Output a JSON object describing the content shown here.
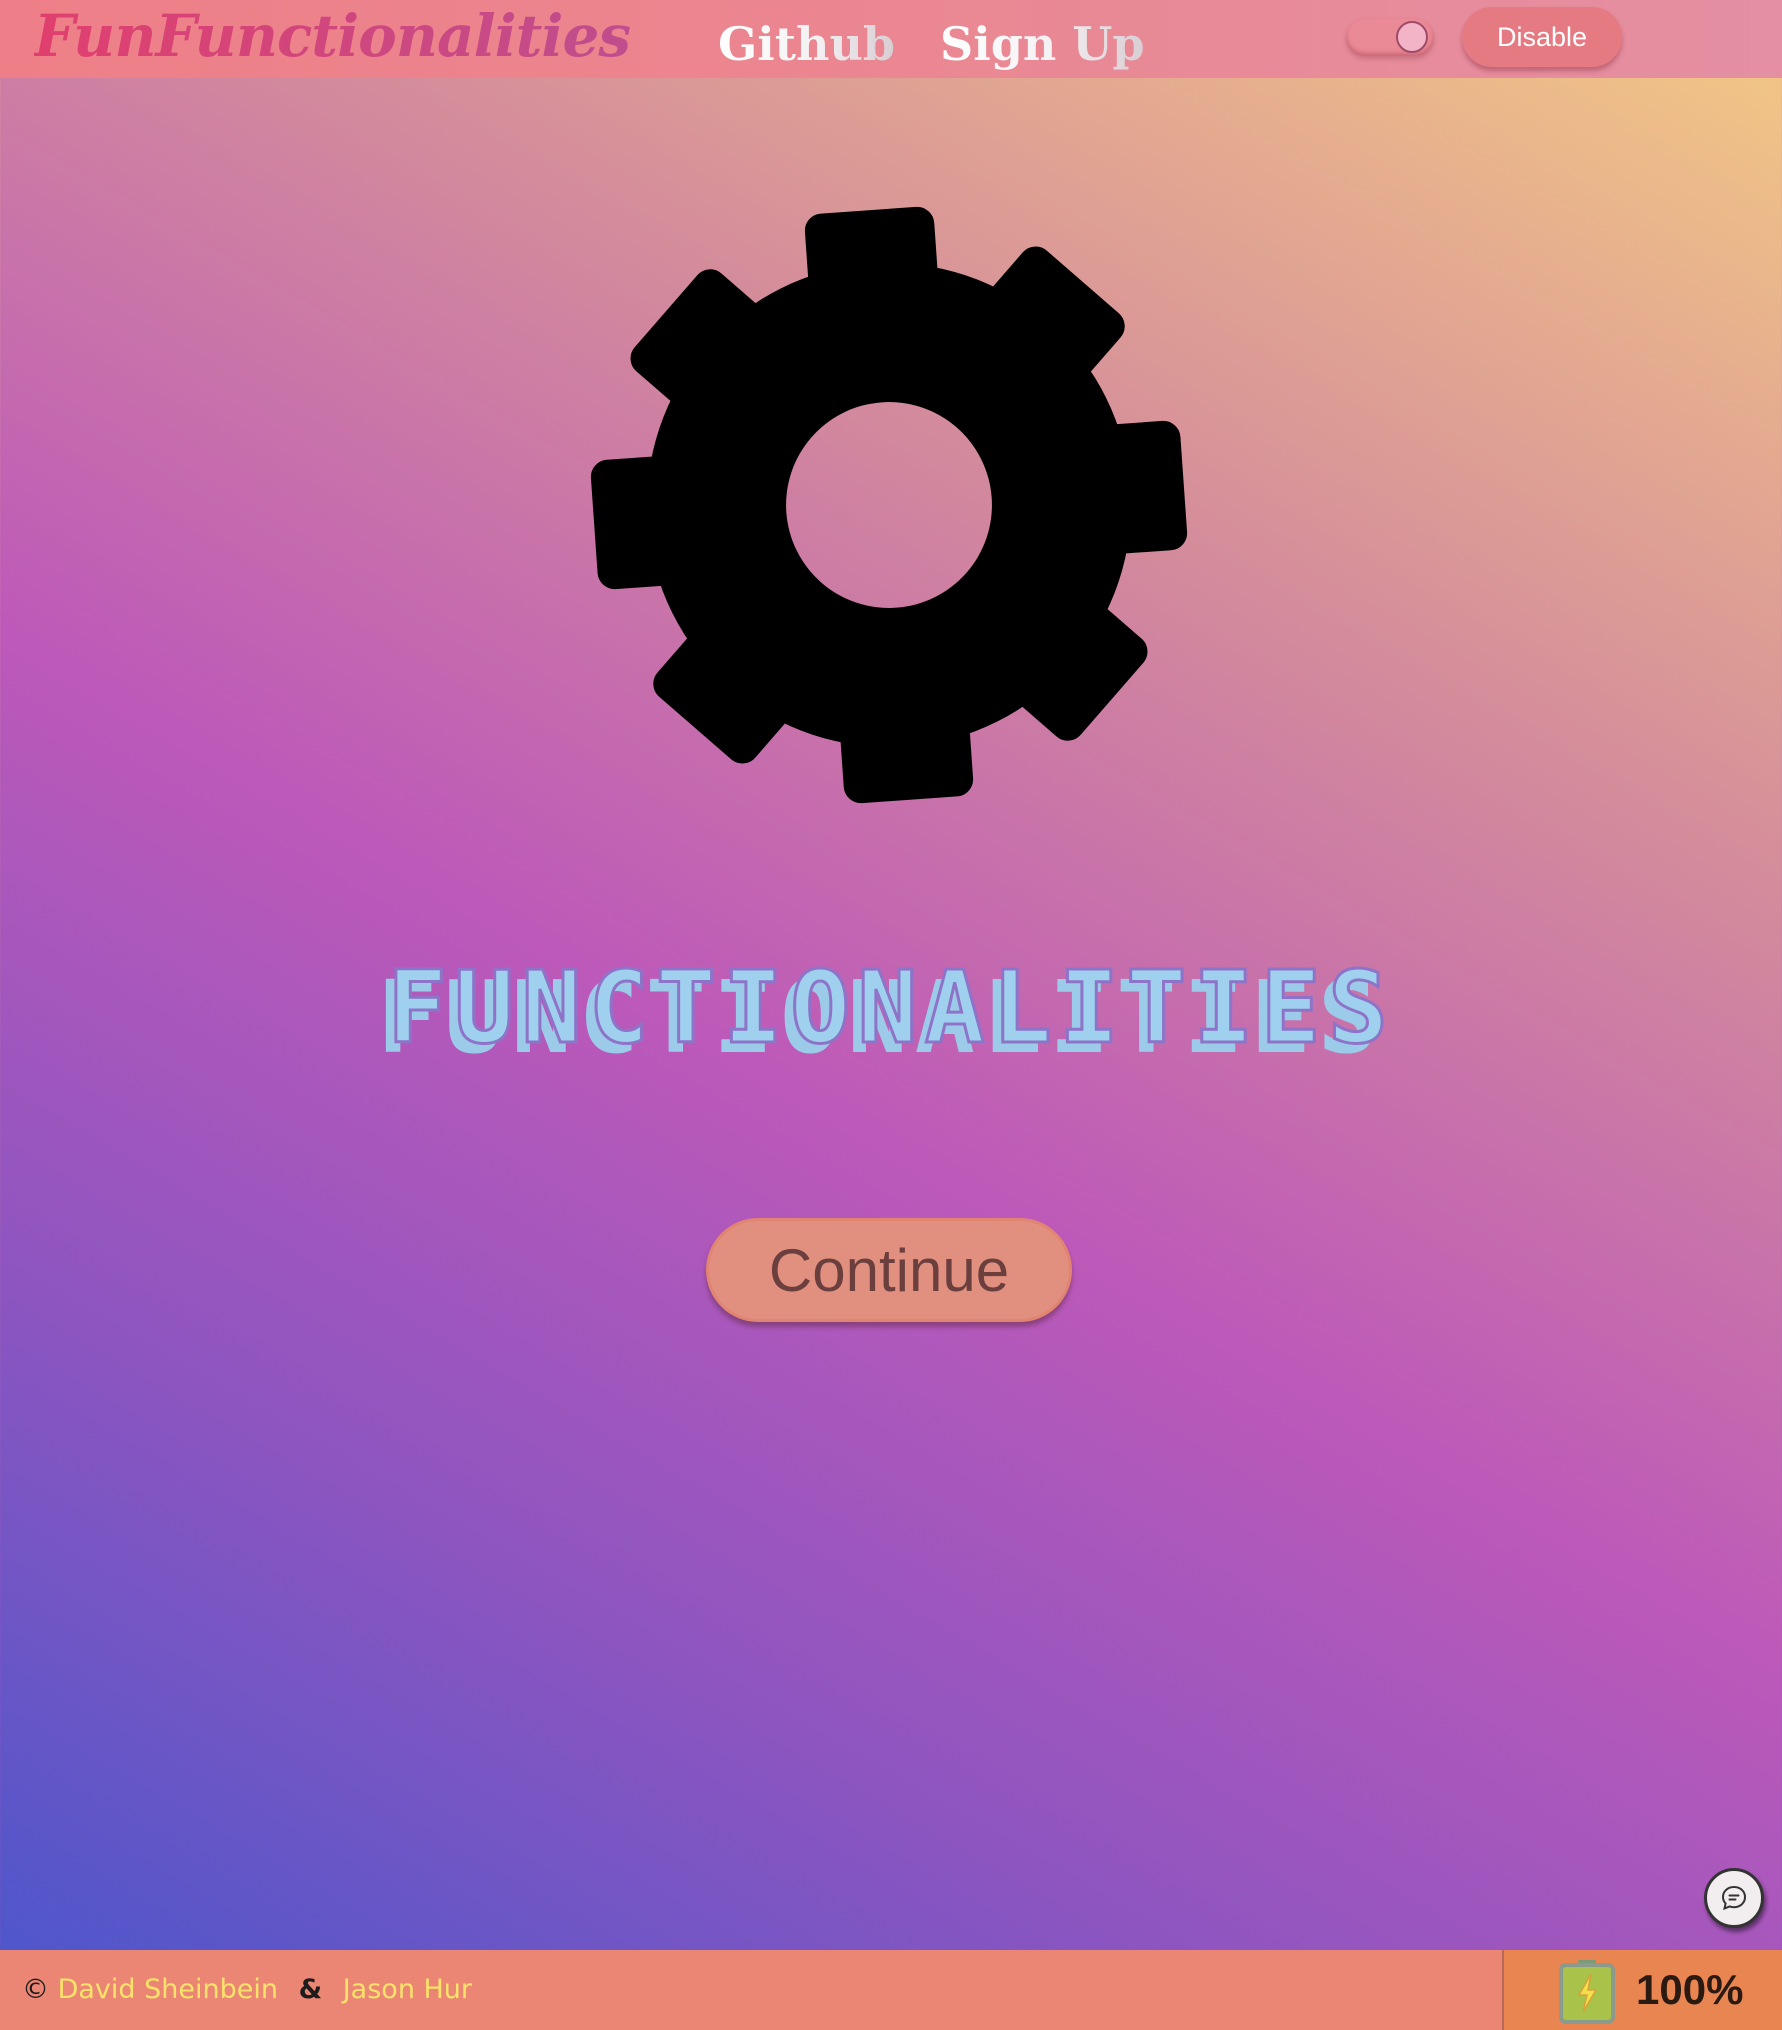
{
  "header": {
    "brand": "FunFunctionalities",
    "nav": {
      "github": "Github",
      "signup": "Sign Up"
    },
    "toggle_state": "on",
    "disable_label": "Disable"
  },
  "main": {
    "icon": "gear-icon",
    "title": "FUNCTIONALITIES",
    "continue_label": "Continue"
  },
  "chat": {
    "icon": "chat-bubble-icon"
  },
  "footer": {
    "copyright_symbol": "©",
    "author1": "David Sheinbein",
    "separator": "&",
    "author2": "Jason Hur",
    "battery_icon": "battery-charging-icon",
    "battery_percent": "100%"
  },
  "colors": {
    "header_bg": "#eb8690",
    "footer_bg": "#ec8674",
    "accent": "#e19080",
    "author_link": "#f8e36a",
    "title_fill": "#9fd0ee",
    "title_outline": "#8e74c8"
  }
}
